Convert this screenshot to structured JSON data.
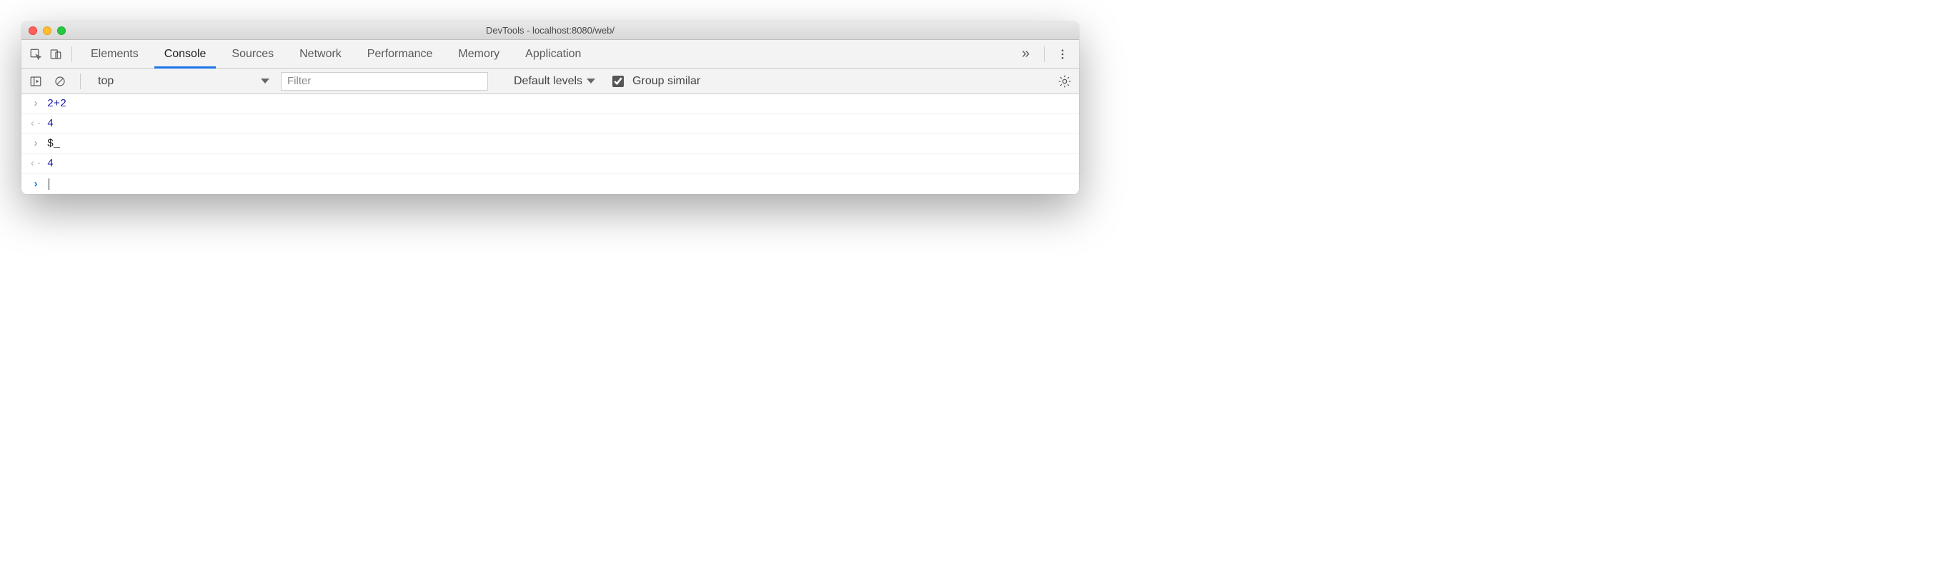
{
  "window": {
    "title": "DevTools - localhost:8080/web/"
  },
  "tabs": {
    "items": [
      {
        "label": "Elements"
      },
      {
        "label": "Console"
      },
      {
        "label": "Sources"
      },
      {
        "label": "Network"
      },
      {
        "label": "Performance"
      },
      {
        "label": "Memory"
      },
      {
        "label": "Application"
      }
    ],
    "active_index": 1,
    "overflow_glyph": "»"
  },
  "toolbar": {
    "context_selected": "top",
    "filter_placeholder": "Filter",
    "levels_label": "Default levels",
    "group_similar_checked": true,
    "group_similar_label": "Group similar"
  },
  "console": {
    "entries": [
      {
        "kind": "input",
        "text": "2+2",
        "render": "expr-2plus2"
      },
      {
        "kind": "result",
        "text": "4"
      },
      {
        "kind": "input",
        "text": "$_",
        "render": "plain"
      },
      {
        "kind": "result",
        "text": "4"
      }
    ]
  }
}
